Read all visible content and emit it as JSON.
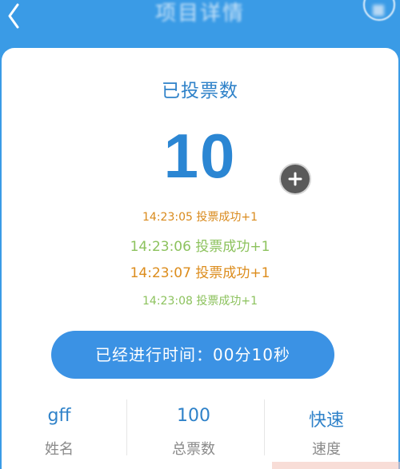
{
  "header": {
    "title": "项目详情",
    "back_icon": "chevron-left-icon"
  },
  "vote": {
    "label": "已投票数",
    "count": "10",
    "add_icon": "plus-circle-icon"
  },
  "log": [
    {
      "time": "14:23:05",
      "text": "投票成功+1",
      "color": "#d98a1c"
    },
    {
      "time": "14:23:06",
      "text": "投票成功+1",
      "color": "#8cc25d"
    },
    {
      "time": "14:23:07",
      "text": "投票成功+1",
      "color": "#dc8c1c"
    },
    {
      "time": "14:23:08",
      "text": "投票成功+1",
      "color": "#8cc25d"
    }
  ],
  "elapsed": {
    "label": "已经进行时间：00分10秒"
  },
  "stats": [
    {
      "value": "gff",
      "label": "姓名"
    },
    {
      "value": "100",
      "label": "总票数"
    },
    {
      "value": "快速",
      "label": "速度"
    }
  ],
  "colors": {
    "header_bg": "#3a9be6",
    "accent": "#2b86d3",
    "button_bg": "#3b92e4"
  }
}
